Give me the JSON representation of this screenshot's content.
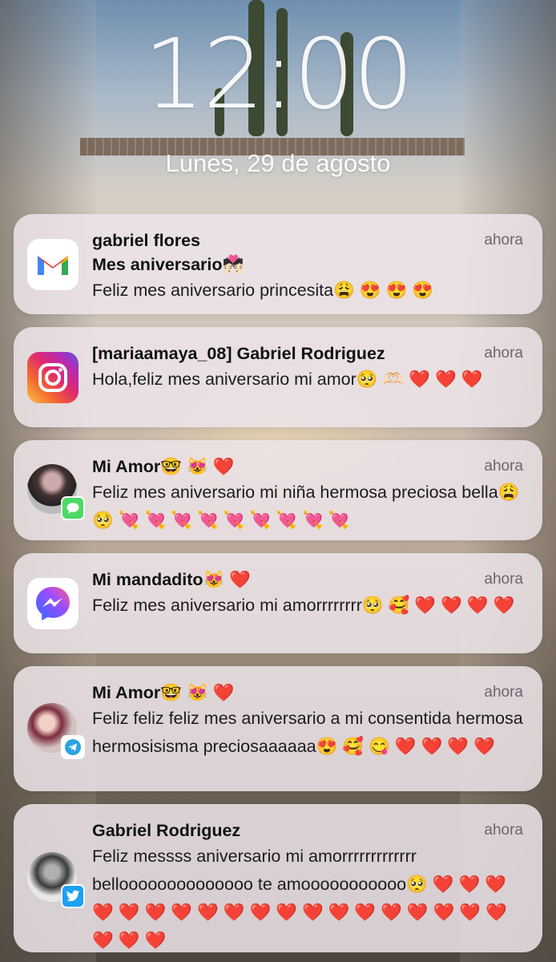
{
  "lockscreen": {
    "time": "12:00",
    "date": "Lunes, 29 de agosto"
  },
  "notifications": [
    {
      "app": "gmail",
      "app_icon": "gmail-icon",
      "sender": "gabriel flores",
      "time": "ahora",
      "subject": "Mes aniversario💏🏻",
      "message": "Feliz mes aniversario princesita😩 😍 😍 😍"
    },
    {
      "app": "instagram",
      "app_icon": "instagram-icon",
      "sender": "[mariaamaya_08] Gabriel Rodriguez",
      "time": "ahora",
      "message": "Hola,feliz mes aniversario mi amor🥺 🫶🏻 ❤️ ❤️ ❤️"
    },
    {
      "app": "messages",
      "app_icon": "messages-icon",
      "sender": "Mi Amor🤓 😻 ❤️",
      "time": "ahora",
      "message": "Feliz mes aniversario mi niña hermosa preciosa bella😩 🥺 💘 💘 💘 💘 💘 💘 💘 💘 💘"
    },
    {
      "app": "messenger",
      "app_icon": "messenger-icon",
      "sender": "Mi mandadito😻 ❤️",
      "time": "ahora",
      "message": "Feliz mes aniversario mi amorrrrrrrr🥺 🥰 ❤️ ❤️ ❤️ ❤️"
    },
    {
      "app": "telegram",
      "app_icon": "telegram-icon",
      "sender": "Mi Amor🤓 😻 ❤️",
      "time": "ahora",
      "message": "Feliz feliz feliz mes aniversario a mi consentida hermosa hermosisisma preciosaaaaaa😍 🥰 😋 ❤️ ❤️ ❤️ ❤️"
    },
    {
      "app": "twitter",
      "app_icon": "twitter-icon",
      "sender": "Gabriel Rodriguez",
      "time": "ahora",
      "message": "Feliz messss aniversario mi amorrrrrrrrrrrrr belloooooooooooooo te amooooooooooo🥺 ❤️ ❤️ ❤️ ❤️ ❤️ ❤️ ❤️ ❤️ ❤️ ❤️ ❤️ ❤️ ❤️ ❤️ ❤️ ❤️ ❤️ ❤️ ❤️ ❤️ ❤️ ❤️"
    }
  ],
  "colors": {
    "card_bg": "#ece4e9",
    "time_text": "#6a6670",
    "gmail_red": "#ea4335",
    "messenger_blue": "#5b6cff",
    "imessage_green": "#4cd964",
    "twitter_blue": "#1da1f2"
  }
}
